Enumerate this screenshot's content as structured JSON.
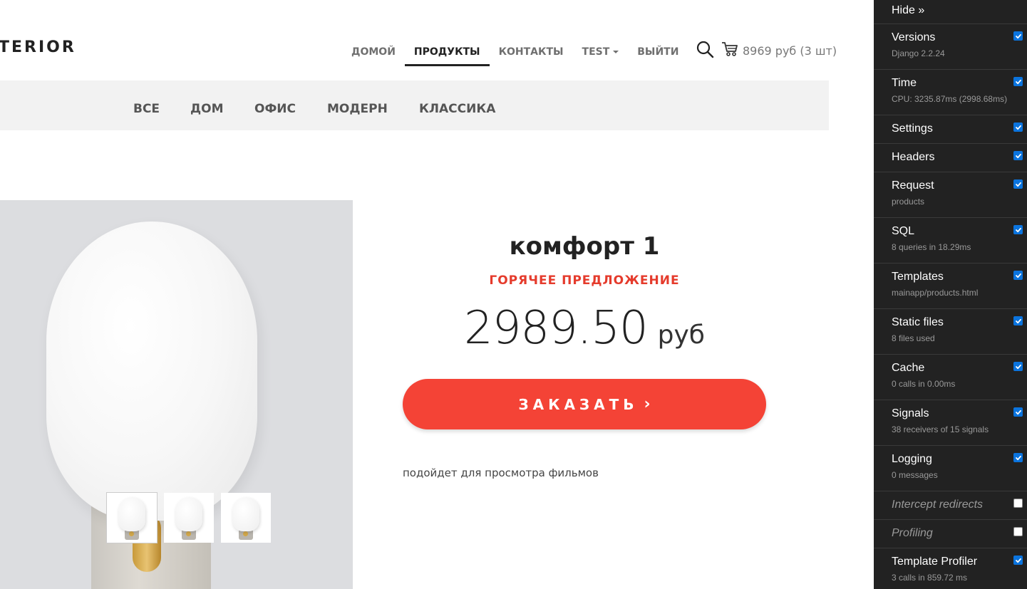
{
  "header": {
    "logo_text": "TERIOR",
    "nav": [
      {
        "label": "ДОМОЙ",
        "active": false
      },
      {
        "label": "ПРОДУКТЫ",
        "active": true
      },
      {
        "label": "КОНТАКТЫ",
        "active": false
      },
      {
        "label": "TEST",
        "active": false,
        "dropdown": true
      },
      {
        "label": "ВЫЙТИ",
        "active": false
      }
    ],
    "cart_text": "8969 руб (3 шт)",
    "search_icon": "search-icon",
    "cart_icon": "cart-icon"
  },
  "categories": [
    "ВСЕ",
    "ДОМ",
    "ОФИС",
    "МОДЕРН",
    "КЛАССИКА"
  ],
  "product": {
    "name": "комфорт 1",
    "badge": "ГОРЯЧЕЕ ПРЕДЛОЖЕНИЕ",
    "price": "2989.50",
    "currency": "руб",
    "order_label": "ЗАКАЗАТЬ",
    "order_arrow": "›",
    "description": "подойдет для просмотра фильмов"
  },
  "colors": {
    "accent": "#f44336",
    "badge": "#e53b2c",
    "toolbar_bg": "#222222"
  },
  "debug_toolbar": {
    "hide_label": "Hide »",
    "panels": [
      {
        "title": "Versions",
        "subtitle": "Django 2.2.24",
        "checked": true
      },
      {
        "title": "Time",
        "subtitle": "CPU: 3235.87ms (2998.68ms)",
        "checked": true
      },
      {
        "title": "Settings",
        "subtitle": "",
        "checked": true
      },
      {
        "title": "Headers",
        "subtitle": "",
        "checked": true
      },
      {
        "title": "Request",
        "subtitle": "products",
        "checked": true
      },
      {
        "title": "SQL",
        "subtitle": "8 queries in 18.29ms",
        "checked": true
      },
      {
        "title": "Templates",
        "subtitle": "mainapp/products.html",
        "checked": true
      },
      {
        "title": "Static files",
        "subtitle": "8 files used",
        "checked": true
      },
      {
        "title": "Cache",
        "subtitle": "0 calls in 0.00ms",
        "checked": true
      },
      {
        "title": "Signals",
        "subtitle": "38 receivers of 15 signals",
        "checked": true
      },
      {
        "title": "Logging",
        "subtitle": "0 messages",
        "checked": true
      },
      {
        "title": "Intercept redirects",
        "subtitle": "",
        "checked": false
      },
      {
        "title": "Profiling",
        "subtitle": "",
        "checked": false
      },
      {
        "title": "Template Profiler",
        "subtitle": "3 calls in 859.72 ms",
        "checked": true
      }
    ]
  }
}
